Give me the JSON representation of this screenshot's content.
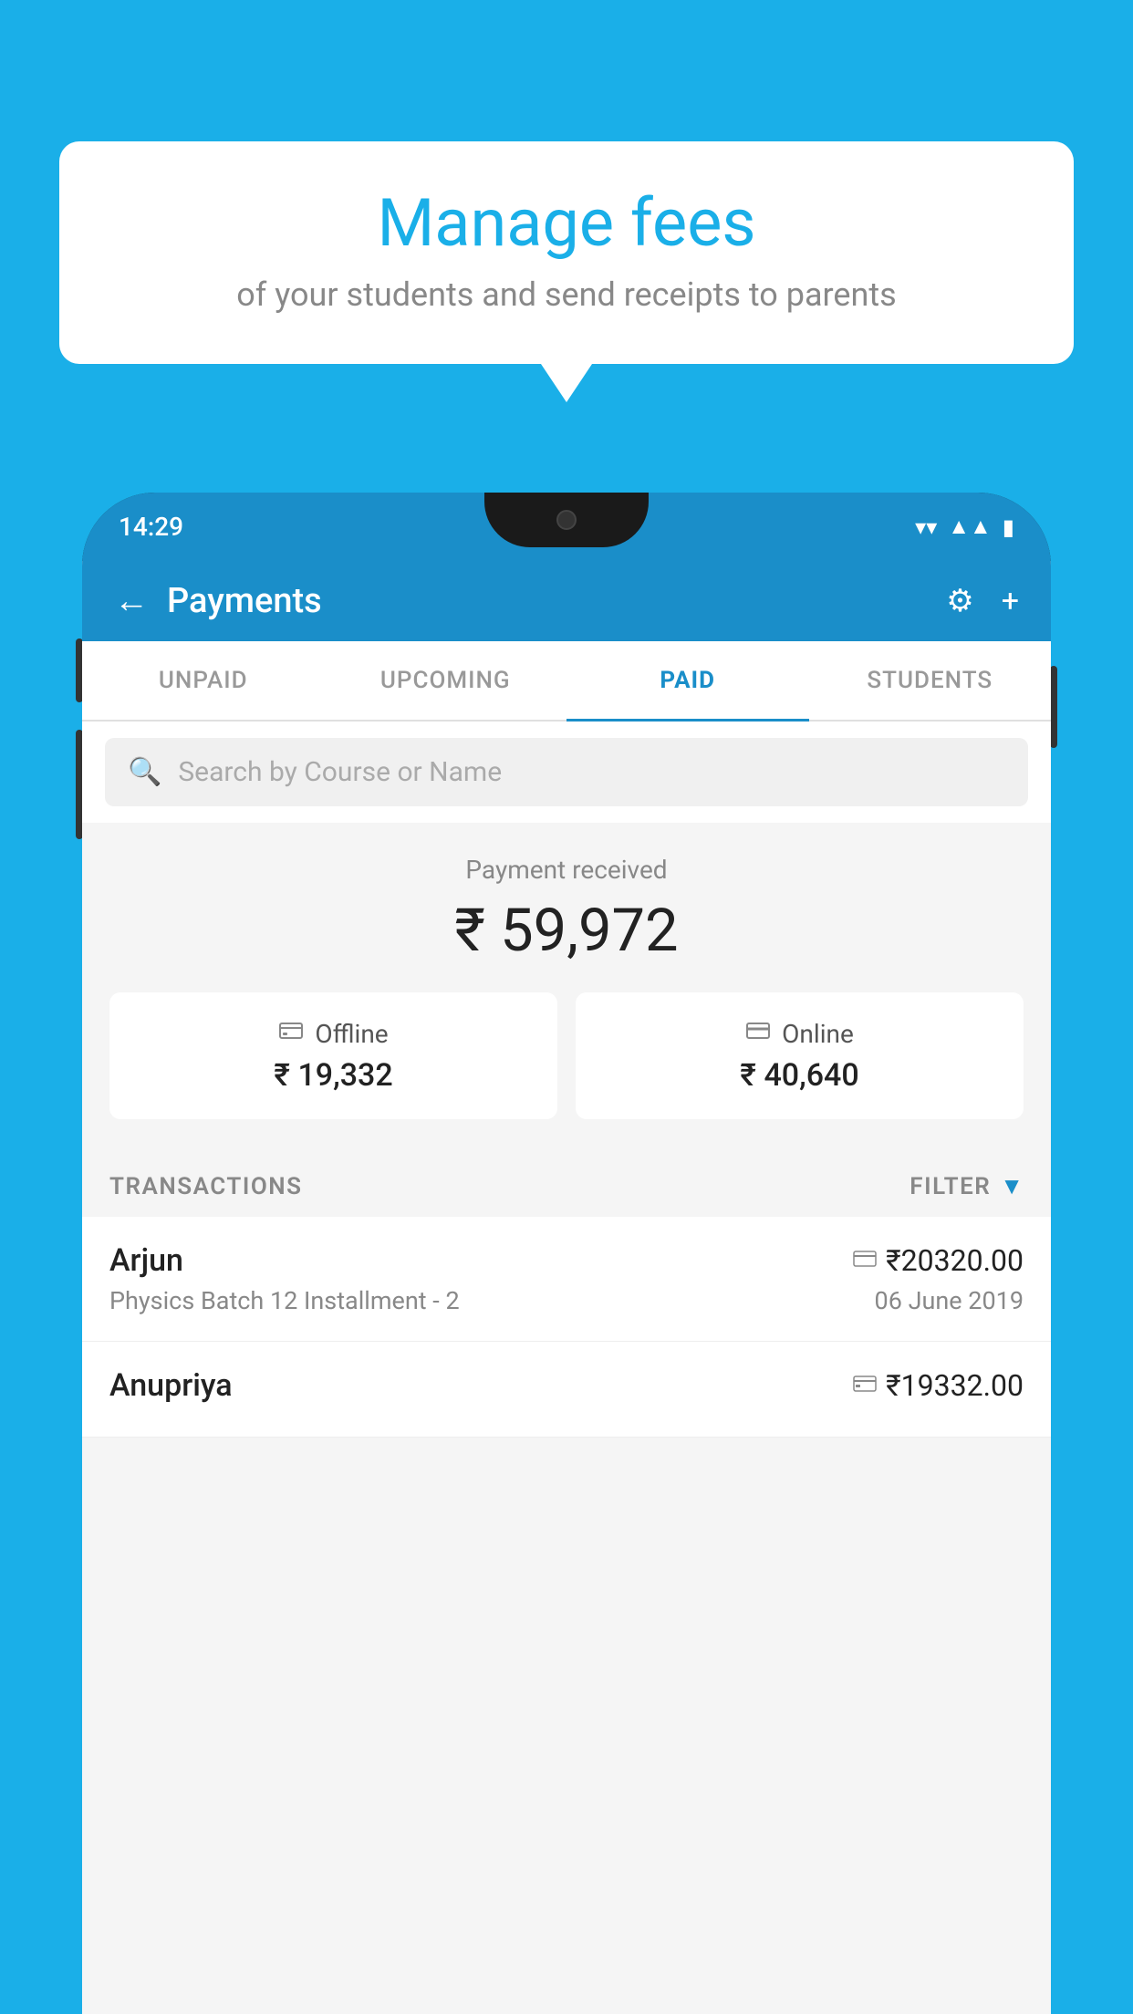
{
  "page": {
    "background_color": "#1AAFE8"
  },
  "bubble": {
    "title": "Manage fees",
    "subtitle": "of your students and send receipts to parents"
  },
  "status_bar": {
    "time": "14:29",
    "wifi_icon": "▼",
    "signal_icon": "▲",
    "battery_icon": "▮"
  },
  "header": {
    "back_label": "←",
    "title": "Payments",
    "settings_icon": "⚙",
    "add_icon": "+"
  },
  "tabs": [
    {
      "label": "UNPAID",
      "active": false
    },
    {
      "label": "UPCOMING",
      "active": false
    },
    {
      "label": "PAID",
      "active": true
    },
    {
      "label": "STUDENTS",
      "active": false
    }
  ],
  "search": {
    "placeholder": "Search by Course or Name"
  },
  "payment_summary": {
    "received_label": "Payment received",
    "total_amount": "₹ 59,972",
    "offline": {
      "icon": "💳",
      "label": "Offline",
      "amount": "₹ 19,332"
    },
    "online": {
      "icon": "💳",
      "label": "Online",
      "amount": "₹ 40,640"
    }
  },
  "transactions": {
    "label": "TRANSACTIONS",
    "filter_label": "FILTER",
    "items": [
      {
        "name": "Arjun",
        "amount": "₹20320.00",
        "description": "Physics Batch 12 Installment - 2",
        "date": "06 June 2019",
        "payment_type": "online"
      },
      {
        "name": "Anupriya",
        "amount": "₹19332.00",
        "description": "",
        "date": "",
        "payment_type": "offline"
      }
    ]
  }
}
